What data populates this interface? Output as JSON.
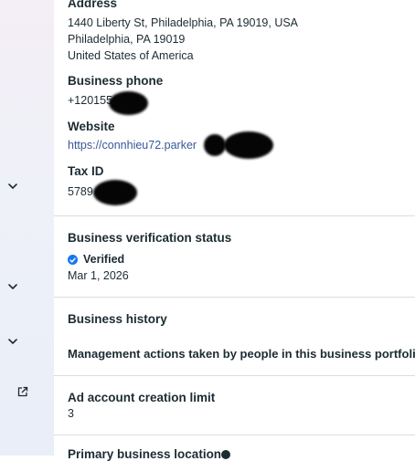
{
  "address": {
    "title": "Address",
    "line1": "1440 Liberty St, Philadelphia, PA 19019, USA",
    "line2": "Philadelphia, PA 19019",
    "line3": "United States of America"
  },
  "phone": {
    "title": "Business phone",
    "value": "+120155"
  },
  "website": {
    "title": "Website",
    "value": "https://connhieu72.parker"
  },
  "tax": {
    "title": "Tax ID",
    "value": "5789"
  },
  "verification": {
    "title": "Business verification status",
    "status": "Verified",
    "date": "Mar 1, 2026"
  },
  "history": {
    "title": "Business history",
    "description": "Management actions taken by people in this business portfolio"
  },
  "ad_limit": {
    "title": "Ad account creation limit",
    "value": "3"
  },
  "primary_location": {
    "title": "Primary business location"
  },
  "sidebar": {
    "icons": [
      "chevron-down-icon",
      "chevron-down-icon",
      "chevron-down-icon",
      "external-link-icon"
    ]
  },
  "colors": {
    "accent": "#1877f2",
    "link": "#385898",
    "divider": "#d9dde1"
  }
}
